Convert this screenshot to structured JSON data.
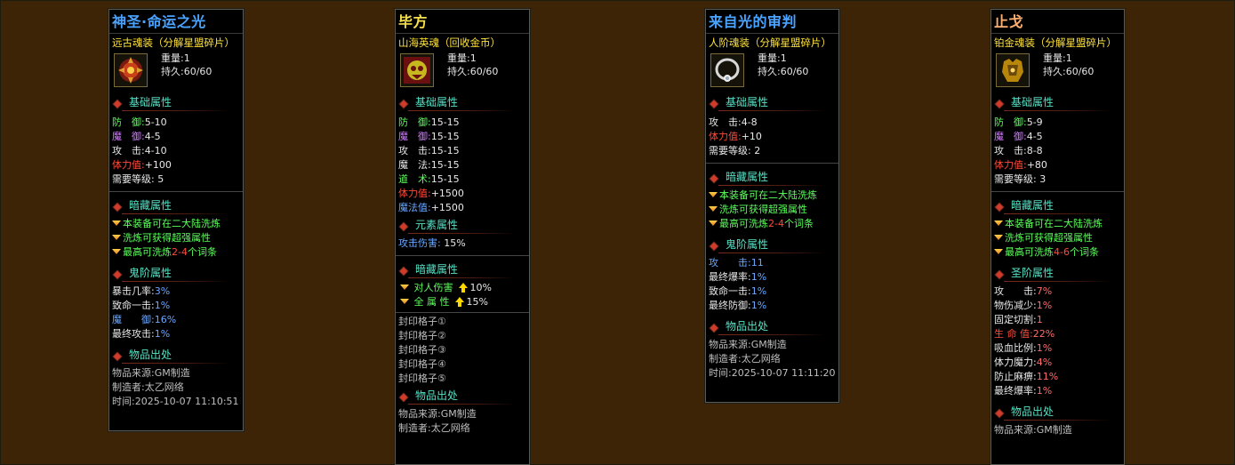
{
  "cards": [
    {
      "title": "神圣·命运之光",
      "subtitle": "远古魂装（分解星盟碎片）",
      "weight": "重量:1",
      "durability": "持久:60/60",
      "icon": "amulet-red-icon",
      "basic_header": "基础属性",
      "basic": [
        {
          "k": "防　御:",
          "v": "5-10"
        },
        {
          "k": "魔　御:",
          "v": "4-5"
        },
        {
          "k": "攻　击:",
          "v": "4-10"
        },
        {
          "k": "体力值:",
          "v": "+100"
        },
        {
          "k": "需要等级:",
          "v": "5"
        }
      ],
      "hidden_header": "暗藏属性",
      "hidden": {
        "l1": "本装备可在二大陆洗炼",
        "l2": "洗炼可获得超强属性",
        "l3a": "最高可洗炼",
        "l3b": "2-4",
        "l3c": "个词条"
      },
      "ghost_header": "鬼阶属性",
      "ghost": [
        {
          "k": "暴击几率:",
          "v": "3%"
        },
        {
          "k": "致命一击:",
          "v": "1%"
        },
        {
          "k": "魔　　御:",
          "v": "16%"
        },
        {
          "k": "最终攻击:",
          "v": "1%"
        }
      ],
      "origin_header": "物品出处",
      "origin": [
        "物品来源:GM制造",
        "制造者:太乙网络",
        "时间:2025-10-07 11:10:51"
      ]
    },
    {
      "title": "毕方",
      "subtitle": "山海英魂（回收金币）",
      "weight": "重量:1",
      "durability": "持久:60/60",
      "icon": "beast-skull-icon",
      "basic_header": "基础属性",
      "basic": [
        {
          "k": "防　御:",
          "v": "15-15"
        },
        {
          "k": "魔　御:",
          "v": "15-15"
        },
        {
          "k": "攻　击:",
          "v": "15-15"
        },
        {
          "k": "魔　法:",
          "v": "15-15"
        },
        {
          "k": "道　术:",
          "v": "15-15"
        },
        {
          "k": "体力值:",
          "v": "+1500"
        },
        {
          "k": "魔法值:",
          "v": "+1500"
        }
      ],
      "element_header": "元素属性",
      "element": [
        {
          "k": "攻击伤害:",
          "v": "15%"
        }
      ],
      "hidden_header": "暗藏属性",
      "hidden_up": [
        {
          "k": "对人伤害",
          "v": "10%"
        },
        {
          "k": "全 属 性",
          "v": "15%"
        }
      ],
      "seals": [
        "封印格子①",
        "封印格子②",
        "封印格子③",
        "封印格子④",
        "封印格子⑤"
      ],
      "origin_header": "物品出处",
      "origin": [
        "物品来源:GM制造",
        "制造者:太乙网络"
      ]
    },
    {
      "title": "来自光的审判",
      "subtitle": "人阶魂装（分解星盟碎片）",
      "weight": "重量:1",
      "durability": "持久:60/60",
      "icon": "silver-necklace-icon",
      "basic_header": "基础属性",
      "basic": [
        {
          "k": "攻　击:",
          "v": "4-8"
        },
        {
          "k": "体力值:",
          "v": "+10"
        },
        {
          "k": "需要等级:",
          "v": "2"
        }
      ],
      "hidden_header": "暗藏属性",
      "hidden": {
        "l1": "本装备可在二大陆洗炼",
        "l2": "洗炼可获得超强属性",
        "l3a": "最高可洗炼",
        "l3b": "2-4",
        "l3c": "个词条"
      },
      "ghost_header": "鬼阶属性",
      "ghost": [
        {
          "k": "攻　　击:",
          "v": "11"
        },
        {
          "k": "最终爆率:",
          "v": "1%"
        },
        {
          "k": "致命一击:",
          "v": "1%"
        },
        {
          "k": "最终防御:",
          "v": "1%"
        }
      ],
      "origin_header": "物品出处",
      "origin": [
        "物品来源:GM制造",
        "制造者:太乙网络",
        "时间:2025-10-07 11:11:20"
      ]
    },
    {
      "title": "止戈",
      "subtitle": "铂金魂装（分解星盟碎片）",
      "weight": "重量:1",
      "durability": "持久:60/60",
      "icon": "gold-armor-icon",
      "basic_header": "基础属性",
      "basic": [
        {
          "k": "防　御:",
          "v": "5-9"
        },
        {
          "k": "魔　御:",
          "v": "4-5"
        },
        {
          "k": "攻　击:",
          "v": "8-8"
        },
        {
          "k": "体力值:",
          "v": "+80"
        },
        {
          "k": "需要等级:",
          "v": "3"
        }
      ],
      "hidden_header": "暗藏属性",
      "hidden": {
        "l1": "本装备可在二大陆洗炼",
        "l2": "洗炼可获得超强属性",
        "l3a": "最高可洗炼",
        "l3b": "4-6",
        "l3c": "个词条"
      },
      "saint_header": "圣阶属性",
      "saint": [
        {
          "k": "攻　　击:",
          "v": "7%"
        },
        {
          "k": "物伤减少:",
          "v": "1%"
        },
        {
          "k": "固定切割:",
          "v": "1"
        },
        {
          "k": "生 命 值:",
          "v": "22%"
        },
        {
          "k": "吸血比例:",
          "v": "1%"
        },
        {
          "k": "体力魔力:",
          "v": "4%"
        },
        {
          "k": "防止麻痹:",
          "v": "11%"
        },
        {
          "k": "最终爆率:",
          "v": "1%"
        }
      ],
      "origin_header": "物品出处",
      "origin": [
        "物品来源:GM制造"
      ]
    }
  ]
}
